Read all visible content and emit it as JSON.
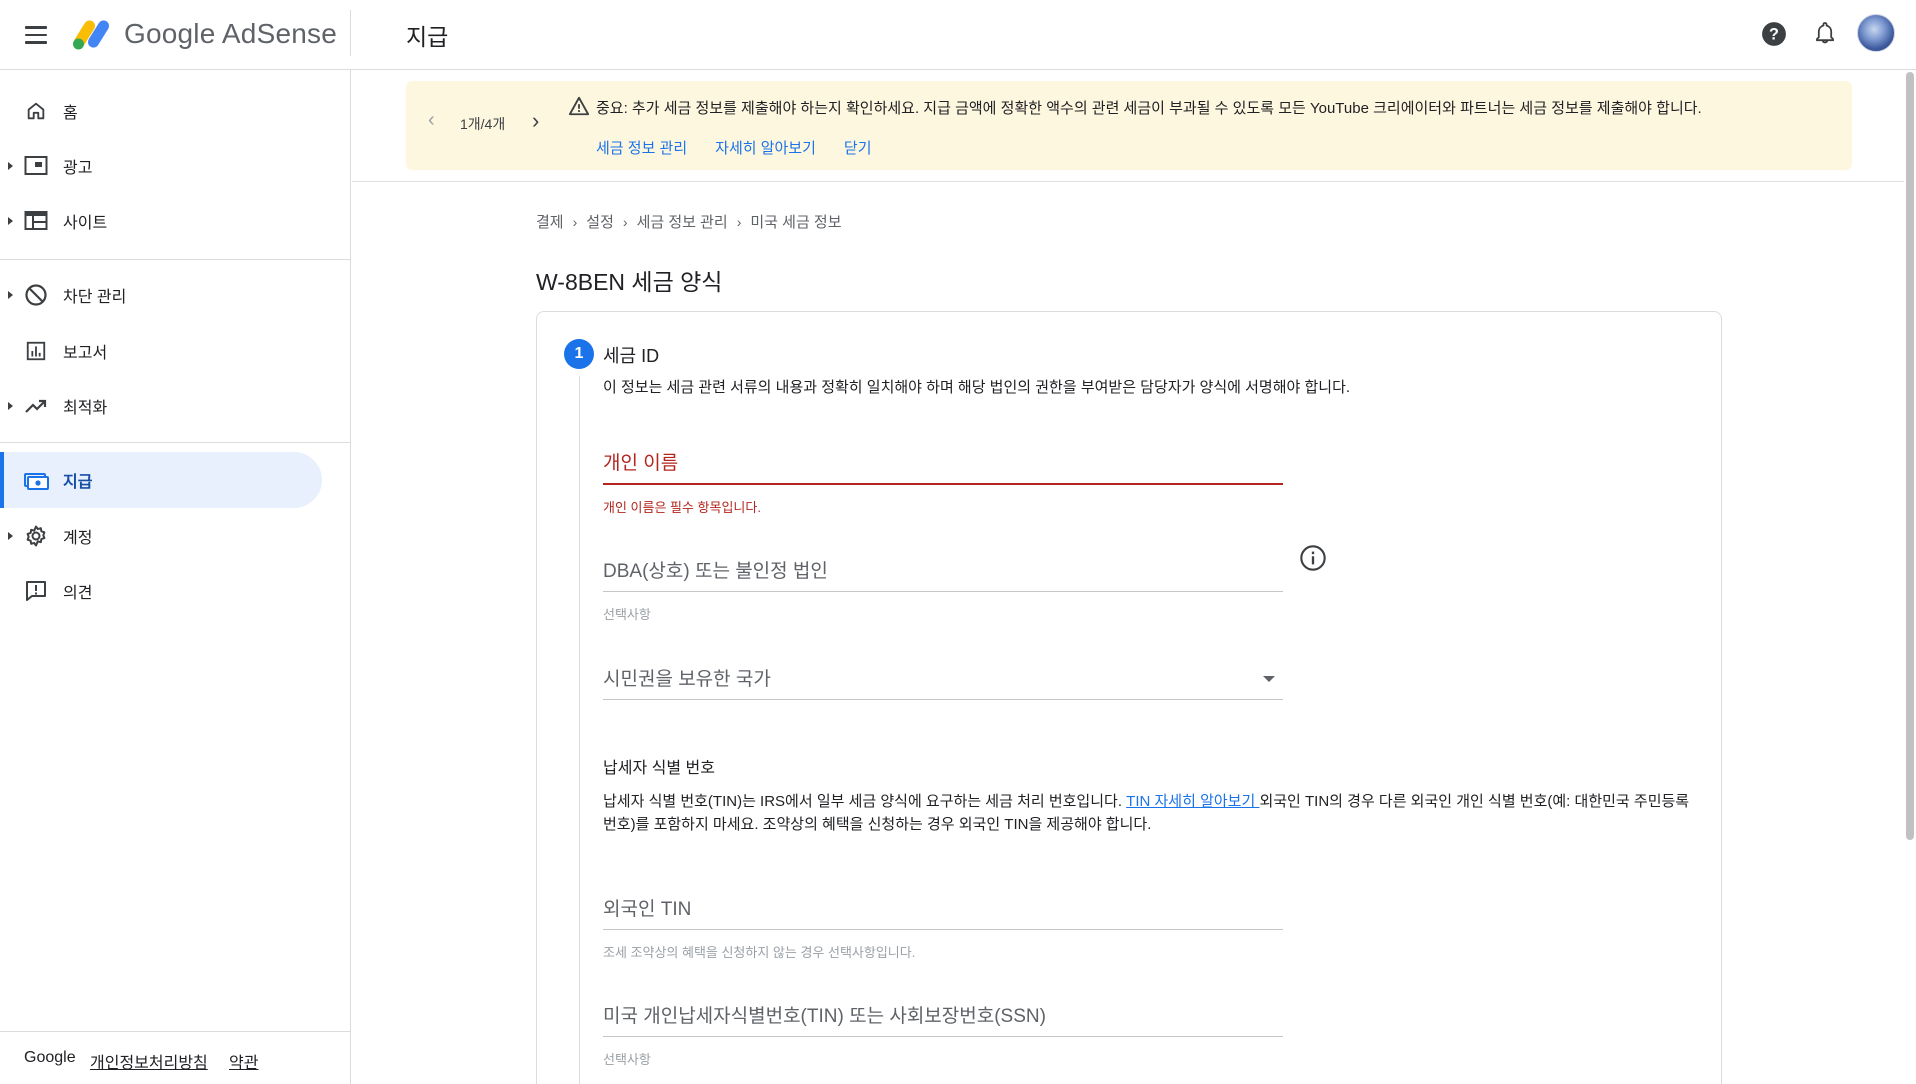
{
  "header": {
    "brand": "Google AdSense",
    "page_title": "지급",
    "icons": [
      "help-icon",
      "notifications-icon",
      "account-avatar"
    ]
  },
  "sidebar": {
    "items": [
      {
        "label": "홈",
        "icon": "home-icon",
        "expandable": false,
        "active": false
      },
      {
        "label": "광고",
        "icon": "ads-icon",
        "expandable": true,
        "active": false
      },
      {
        "label": "사이트",
        "icon": "sites-icon",
        "expandable": true,
        "active": false
      },
      {
        "label": "차단 관리",
        "icon": "block-icon",
        "expandable": true,
        "active": false
      },
      {
        "label": "보고서",
        "icon": "reports-icon",
        "expandable": false,
        "active": false
      },
      {
        "label": "최적화",
        "icon": "trending-icon",
        "expandable": true,
        "active": false
      },
      {
        "label": "지급",
        "icon": "payments-icon",
        "expandable": false,
        "active": true
      },
      {
        "label": "계정",
        "icon": "settings-icon",
        "expandable": true,
        "active": false
      },
      {
        "label": "의견",
        "icon": "feedback-icon",
        "expandable": false,
        "active": false
      }
    ],
    "footer": {
      "brand": "Google",
      "privacy": "개인정보처리방침",
      "terms": "약관"
    }
  },
  "banner": {
    "pager": "1개/4개",
    "message": "중요: 추가 세금 정보를 제출해야 하는지 확인하세요. 지급 금액에 정확한 액수의 관련 세금이 부과될 수 있도록 모든 YouTube 크리에이터와 파트너는 세금 정보를 제출해야 합니다.",
    "links": [
      "세금 정보 관리",
      "자세히 알아보기",
      "닫기"
    ]
  },
  "breadcrumb": [
    "결제",
    "설정",
    "세금 정보 관리",
    "미국 세금 정보"
  ],
  "form": {
    "title": "W-8BEN 세금 양식",
    "step": {
      "number": "1",
      "title": "세금 ID",
      "description": "이 정보는 세금 관련 서류의 내용과 정확히 일치해야 하며 해당 법인의 권한을 부여받은 담당자가 양식에 서명해야 합니다."
    },
    "fields": {
      "individual_name": {
        "label": "개인 이름",
        "error": "개인 이름은 필수 항목입니다."
      },
      "dba": {
        "label": "DBA(상호) 또는 불인정 법인",
        "hint": "선택사항"
      },
      "citizenship": {
        "label": "시민권을 보유한 국가"
      },
      "foreign_tin": {
        "label": "외국인 TIN",
        "hint": "조세 조약상의 혜택을 신청하지 않는 경우 선택사항입니다."
      },
      "us_tin": {
        "label": "미국 개인납세자식별번호(TIN) 또는 사회보장번호(SSN)",
        "hint": "선택사항"
      }
    },
    "tin_section": {
      "heading": "납세자 식별 번호",
      "text_before": "납세자 식별 번호(TIN)는 IRS에서 일부 세금 양식에 요구하는 세금 처리 번호입니다. ",
      "link": "TIN 자세히 알아보기 ",
      "text_after": "외국인 TIN의 경우 다른 외국인 개인 식별 번호(예: 대한민국 주민등록번호)를 포함하지 마세요. 조약상의 혜택을 신청하는 경우 외국인 TIN을 제공해야 합니다."
    }
  },
  "colors": {
    "accent": "#1a73e8",
    "error": "#b3261e",
    "banner_bg": "#fef7e0",
    "active_nav_bg": "#e8f0fe"
  }
}
